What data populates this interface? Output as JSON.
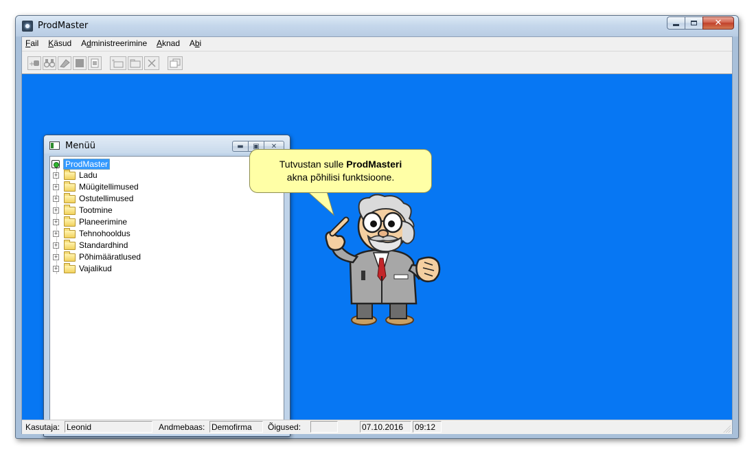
{
  "window": {
    "title": "ProdMaster"
  },
  "menubar": {
    "items": [
      {
        "label": "Fail",
        "key": "F"
      },
      {
        "label": "Käsud",
        "key": "K"
      },
      {
        "label": "Administreerimine",
        "key": "d"
      },
      {
        "label": "Aknad",
        "key": "A"
      },
      {
        "label": "Abi",
        "key": "b"
      }
    ]
  },
  "toolbar": {
    "buttons": [
      "add-icon",
      "binoculars-icon",
      "eraser-icon",
      "stop-icon",
      "document-icon",
      "new-folder-icon",
      "folder-icon",
      "close-icon",
      "copy-window-icon"
    ]
  },
  "menu_window": {
    "title": "Menüü",
    "root": "ProdMaster",
    "items": [
      "Ladu",
      "Müügitellimused",
      "Ostutellimused",
      "Tootmine",
      "Planeerimine",
      "Tehnohooldus",
      "Standardhind",
      "Põhimääratlused",
      "Vajalikud"
    ]
  },
  "bubble": {
    "line1_prefix": "Tutvustan sulle ",
    "line1_bold": "ProdMasteri",
    "line2": "akna põhilisi funktsioone."
  },
  "statusbar": {
    "user_label": "Kasutaja:",
    "user_value": "Leonid",
    "db_label": "Andmebaas:",
    "db_value": "Demofirma",
    "rights_label": "Õigused:",
    "rights_value": "",
    "date": "07.10.2016",
    "time": "09:12"
  },
  "colors": {
    "workspace": "#0777f3",
    "bubble": "#ffffa6",
    "selection": "#3399ff"
  }
}
